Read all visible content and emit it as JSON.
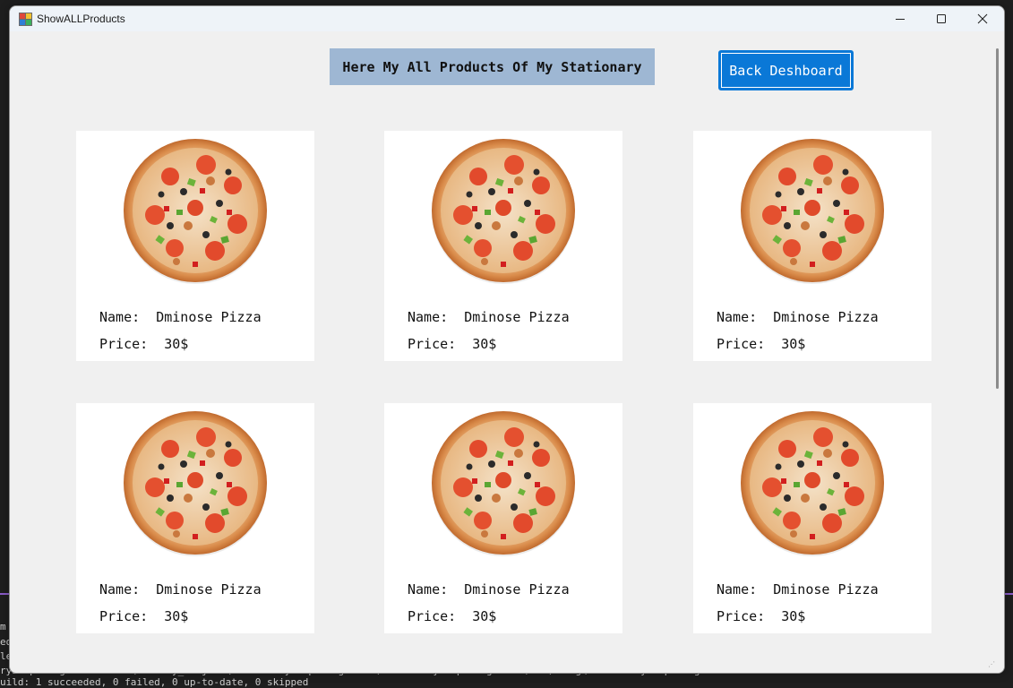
{
  "window": {
    "title": "ShowALLProducts"
  },
  "header": {
    "label": "Here My All Products Of My Stationary",
    "back_button_label": "Back Deshboard"
  },
  "products": [
    {
      "name_label": "Name:",
      "name": "Dminose Pizza",
      "price_label": "Price:",
      "price": "30$"
    },
    {
      "name_label": "Name:",
      "name": "Dminose Pizza",
      "price_label": "Price:",
      "price": "30$"
    },
    {
      "name_label": "Name:",
      "name": "Dminose Pizza",
      "price_label": "Price:",
      "price": "30$"
    },
    {
      "name_label": "Name:",
      "name": "Dminose Pizza",
      "price_label": "Price:",
      "price": "30$"
    },
    {
      "name_label": "Name:",
      "name": "Dminose Pizza",
      "price_label": "Price:",
      "price": "30$"
    },
    {
      "name_label": "Name:",
      "name": "Dminose Pizza",
      "price_label": "Price:",
      "price": "30$"
    }
  ],
  "background_console": [
    "m",
    "ed",
    "le",
    "ryShopManagement -> D:\\Versity_Project\\StationaryShopManagement\\StationaryShopManagement\\bin\\Debug\\StationaryShopManagement.exe",
    "uild: 1 succeeded, 0 failed, 0 up-to-date, 0 skipped"
  ],
  "colors": {
    "window_bg": "#f0f0f0",
    "header_label_bg": "#9eb7d3",
    "button_bg": "#0a78d7",
    "card_bg": "#ffffff"
  }
}
